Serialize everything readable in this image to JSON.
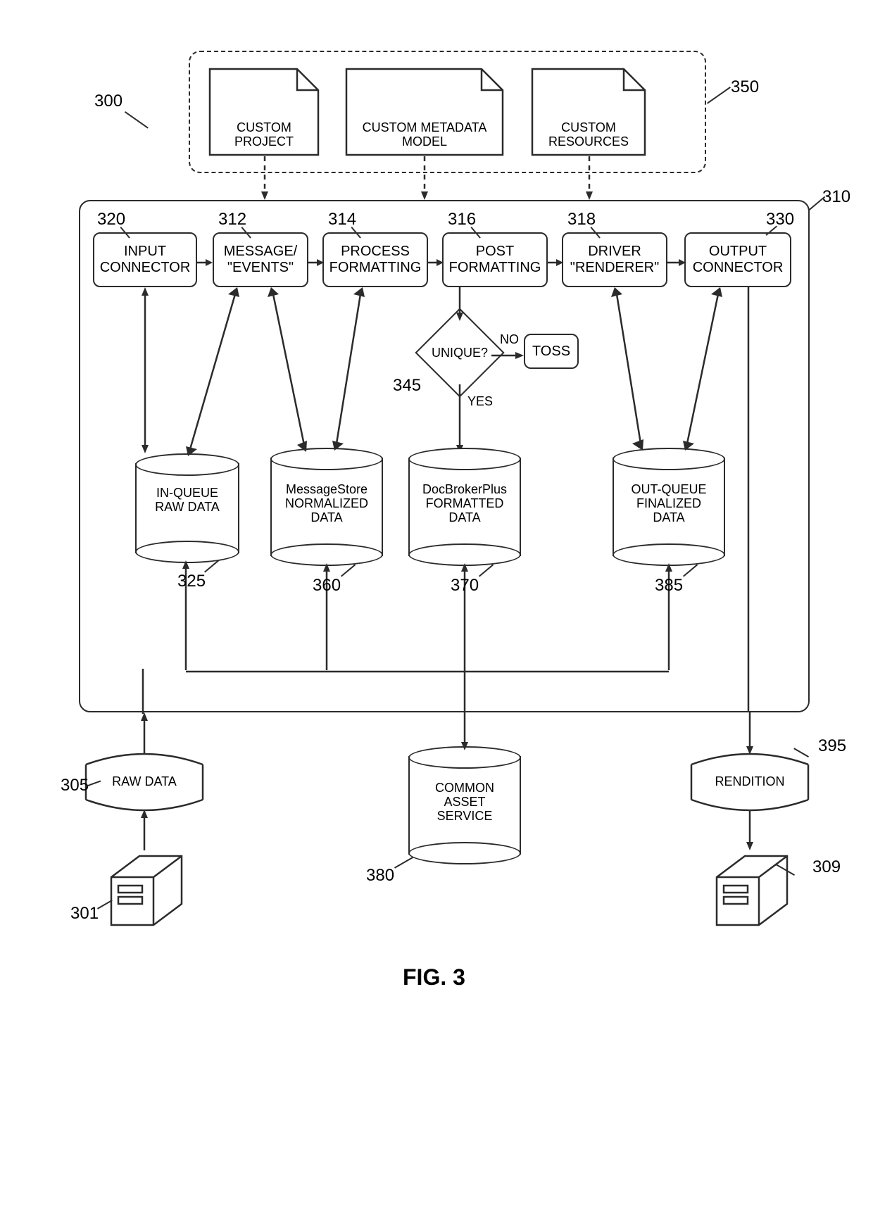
{
  "figure": {
    "caption": "FIG. 3"
  },
  "refs": {
    "r300": "300",
    "r350": "350",
    "r310": "310",
    "r320": "320",
    "r312": "312",
    "r314": "314",
    "r316": "316",
    "r318": "318",
    "r330": "330",
    "r345": "345",
    "r325": "325",
    "r360": "360",
    "r370": "370",
    "r380": "380",
    "r385": "385",
    "r305": "305",
    "r301": "301",
    "r395": "395",
    "r309": "309"
  },
  "blocks": {
    "input_connector": "INPUT\nCONNECTOR",
    "message_events": "MESSAGE/\n\"EVENTS\"",
    "process_formatting": "PROCESS\nFORMATTING",
    "post_formatting": "POST\nFORMATTING",
    "driver_renderer": "DRIVER\n\"RENDERER\"",
    "output_connector": "OUTPUT\nCONNECTOR",
    "toss": "TOSS",
    "unique": "UNIQUE?",
    "yes": "YES",
    "no": "NO"
  },
  "docs": {
    "custom_project": "CUSTOM\nPROJECT",
    "custom_metadata_model": "CUSTOM METADATA\nMODEL",
    "custom_resources": "CUSTOM\nRESOURCES"
  },
  "cyls": {
    "in_queue": "IN-QUEUE\nRAW DATA",
    "msgstore": "MessageStore\nNORMALIZED\nDATA",
    "docbroker": "DocBrokerPlus\nFORMATTED\nDATA",
    "out_queue": "OUT-QUEUE\nFINALIZED\nDATA",
    "cas": "COMMON\nASSET\nSERVICE"
  },
  "chans": {
    "raw_data": "RAW DATA",
    "rendition": "RENDITION"
  }
}
